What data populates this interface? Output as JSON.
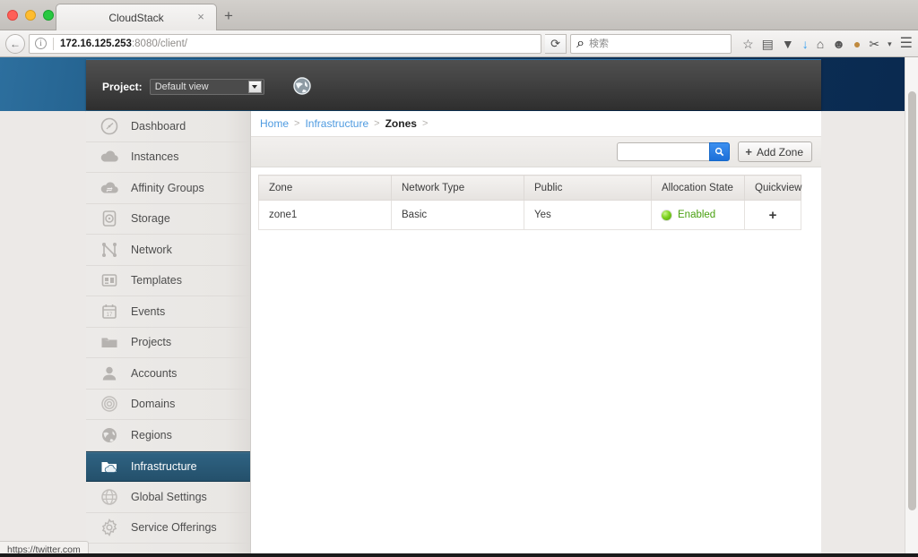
{
  "browser": {
    "tab_title": "CloudStack",
    "tab_close_icon": "×",
    "new_tab_icon": "+",
    "back_icon": "←",
    "info_icon": "i",
    "url_host": "172.16.125.253",
    "url_path": ":8080/client/",
    "reload_icon": "⟳",
    "search_placeholder": "検索",
    "search_value": "",
    "search_icon": "⌕",
    "toolbar_icons": [
      {
        "name": "bookmark-star-icon",
        "glyph": "☆"
      },
      {
        "name": "reader-view-icon",
        "glyph": "▤"
      },
      {
        "name": "pocket-icon",
        "glyph": "▼"
      },
      {
        "name": "downloads-icon",
        "glyph": "↓"
      },
      {
        "name": "home-icon",
        "glyph": "⌂"
      },
      {
        "name": "chat-icon",
        "glyph": "☻"
      },
      {
        "name": "cookie-icon",
        "glyph": "●"
      },
      {
        "name": "plugin-icon",
        "glyph": "✂"
      },
      {
        "name": "overflow-chevron-icon",
        "glyph": "▾"
      },
      {
        "name": "hamburger-menu-icon",
        "glyph": "☰"
      }
    ]
  },
  "header": {
    "project_label": "Project:",
    "project_value": "Default view",
    "dropdown_arrow_icon": "caret-down-icon",
    "globe_icon": "globe-icon"
  },
  "sidebar": {
    "items": [
      {
        "label": "Dashboard",
        "icon": "gauge-icon",
        "active": false
      },
      {
        "label": "Instances",
        "icon": "cloud-icon",
        "active": false
      },
      {
        "label": "Affinity Groups",
        "icon": "cloud-sync-icon",
        "active": false
      },
      {
        "label": "Storage",
        "icon": "disk-icon",
        "active": false
      },
      {
        "label": "Network",
        "icon": "network-nodes-icon",
        "active": false
      },
      {
        "label": "Templates",
        "icon": "templates-icon",
        "active": false
      },
      {
        "label": "Events",
        "icon": "calendar-icon",
        "active": false
      },
      {
        "label": "Projects",
        "icon": "folder-icon",
        "active": false
      },
      {
        "label": "Accounts",
        "icon": "user-icon",
        "active": false
      },
      {
        "label": "Domains",
        "icon": "target-rings-icon",
        "active": false
      },
      {
        "label": "Regions",
        "icon": "globe-icon",
        "active": false
      },
      {
        "label": "Infrastructure",
        "icon": "folder-cloud-icon",
        "active": true
      },
      {
        "label": "Global Settings",
        "icon": "globe-grid-icon",
        "active": false
      },
      {
        "label": "Service Offerings",
        "icon": "gear-icon",
        "active": false
      }
    ]
  },
  "breadcrumb": {
    "home": "Home",
    "infrastructure": "Infrastructure",
    "current": "Zones",
    "separator": ">"
  },
  "actionbar": {
    "search_value": "",
    "search_icon": "search-icon",
    "add_zone_label": "Add Zone",
    "add_icon": "+"
  },
  "table": {
    "columns": [
      "Zone",
      "Network Type",
      "Public",
      "Allocation State",
      "Quickview"
    ],
    "rows": [
      {
        "zone": "zone1",
        "network_type": "Basic",
        "public": "Yes",
        "allocation_state": "Enabled",
        "allocation_color": "#49a010",
        "quickview_icon": "+"
      }
    ]
  },
  "statusbar": {
    "text": "https://twitter.com"
  }
}
